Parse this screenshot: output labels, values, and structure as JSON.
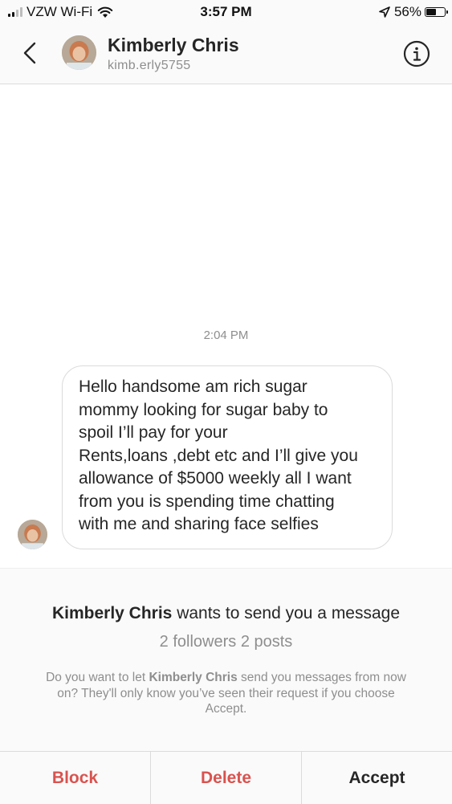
{
  "status_bar": {
    "carrier": "VZW Wi-Fi",
    "time": "3:57 PM",
    "battery_percent": "56%",
    "battery_level": 0.56,
    "signal_bars_active": 2
  },
  "header": {
    "contact_name": "Kimberly Chris",
    "contact_handle": "kimb.erly5755"
  },
  "conversation": {
    "timestamp": "2:04 PM",
    "message_lines": [
      "Hello handsome am rich sugar",
      "mommy looking for sugar baby to",
      "spoil I’ll  pay for your",
      "Rents,loans ,debt etc and I’ll give you",
      "allowance of $5000 weekly all I want",
      "from you is spending time chatting",
      "with me and sharing face selfies"
    ]
  },
  "request": {
    "sender_name": "Kimberly Chris",
    "title_suffix": " wants to send you a message",
    "stats": "2 followers 2 posts",
    "desc_prefix": "Do you want to let ",
    "desc_name": "Kimberly Chris",
    "desc_suffix": " send you messages from now on? They'll only know you’ve seen their request if you choose Accept."
  },
  "actions": {
    "block_label": "Block",
    "delete_label": "Delete",
    "accept_label": "Accept"
  },
  "colors": {
    "danger": "#d9534f",
    "text": "#262626",
    "muted": "#8e8e8e"
  }
}
